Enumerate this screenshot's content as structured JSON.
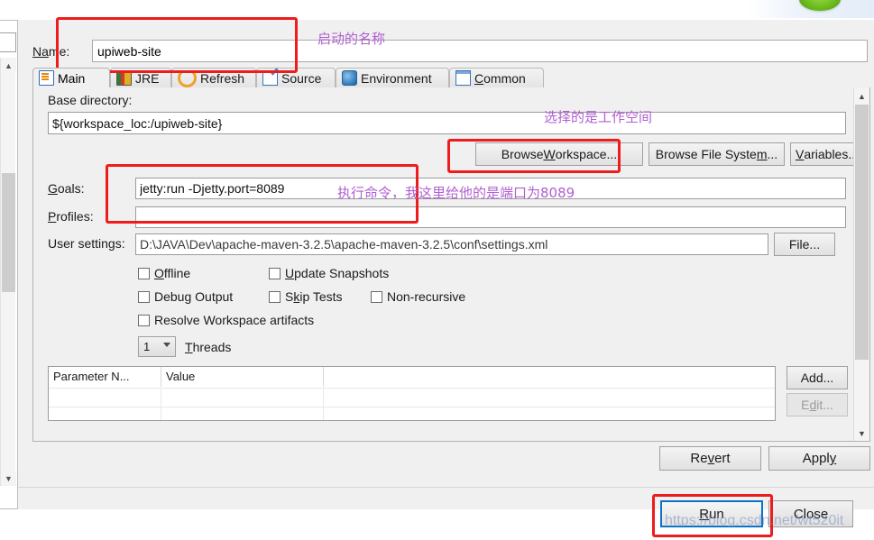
{
  "window": {
    "name_label": "Name:",
    "name_value": "upiweb-site"
  },
  "tabs": [
    {
      "label": "Main",
      "icon": "main-config-icon",
      "selected": true
    },
    {
      "label": "JRE",
      "icon": "jre-books-icon",
      "selected": false
    },
    {
      "label": "Refresh",
      "icon": "refresh-arrows-icon",
      "selected": false
    },
    {
      "label": "Source",
      "icon": "source-pencil-icon",
      "selected": false
    },
    {
      "label": "Environment",
      "icon": "environment-globe-icon",
      "selected": false
    },
    {
      "label": "Common",
      "icon": "common-window-icon",
      "selected": false
    }
  ],
  "main": {
    "base_directory_label": "Base directory:",
    "base_directory_value": "${workspace_loc:/upiweb-site}",
    "browse_workspace_button": "Browse Workspace...",
    "browse_file_system_button": "Browse File System...",
    "variables_button": "Variables...",
    "goals_label": "Goals:",
    "goals_value": "jetty:run -Djetty.port=8089",
    "profiles_label": "Profiles:",
    "profiles_value": "",
    "user_settings_label": "User settings:",
    "user_settings_value": "D:\\JAVA\\Dev\\apache-maven-3.2.5\\apache-maven-3.2.5\\conf\\settings.xml",
    "file_button": "File...",
    "checkboxes": [
      {
        "label": "Offline",
        "checked": false
      },
      {
        "label": "Update Snapshots",
        "checked": false
      },
      {
        "label": "Debug Output",
        "checked": false
      },
      {
        "label": "Skip Tests",
        "checked": false
      },
      {
        "label": "Non-recursive",
        "checked": false
      },
      {
        "label": "Resolve Workspace artifacts",
        "checked": false
      }
    ],
    "threads_value": "1",
    "threads_label": "Threads",
    "parameter_table": {
      "columns": [
        "Parameter N...",
        "Value",
        ""
      ],
      "rows": []
    },
    "add_button": "Add...",
    "edit_button": "Edit..."
  },
  "footer": {
    "revert_button": "Revert",
    "apply_button": "Apply",
    "run_button": "Run",
    "close_button": "Close"
  },
  "annotations": {
    "name_note": "启动的名称",
    "workspace_note": "选择的是工作空间",
    "goals_note": "执行命令，我这里给他的是端口为8089",
    "watermark": "https://blog.csdn.net/wt520it"
  },
  "colors": {
    "annotation_red": "#ee1c1c",
    "annotation_purple": "#b05fd0",
    "focus_blue": "#0a73c8"
  }
}
